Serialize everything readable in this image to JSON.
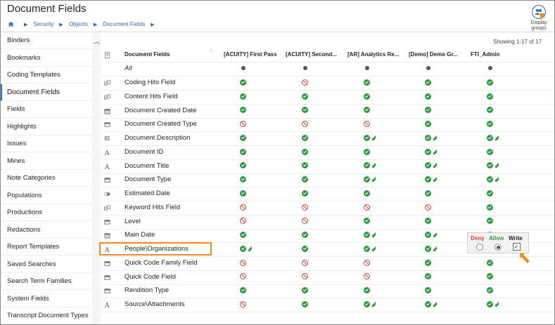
{
  "header": {
    "title": "Document Fields",
    "breadcrumb": [
      "Security",
      "Objects",
      "Document Fields"
    ],
    "display_groups_label_1": "Display",
    "display_groups_label_2": "groups"
  },
  "sidebar": {
    "items": [
      {
        "label": "Binders"
      },
      {
        "label": "Bookmarks"
      },
      {
        "label": "Coding Templates"
      },
      {
        "label": "Document Fields",
        "active": true
      },
      {
        "label": "Fields"
      },
      {
        "label": "Highlights"
      },
      {
        "label": "Issues"
      },
      {
        "label": "Mines"
      },
      {
        "label": "Note Categories"
      },
      {
        "label": "Populations"
      },
      {
        "label": "Productions"
      },
      {
        "label": "Redactions"
      },
      {
        "label": "Report Templates"
      },
      {
        "label": "Saved Searches"
      },
      {
        "label": "Search Term Families"
      },
      {
        "label": "System Fields"
      },
      {
        "label": "Transcript Document Types"
      }
    ]
  },
  "grid": {
    "showing": "Showing 1-17 of 17",
    "columns": [
      "Document Fields",
      "[ACUITY] First Pass",
      "[ACUITY] Second...",
      "[AR] Analytics Re...",
      "[Demo] Demo Gr...",
      "FTI_Admin"
    ],
    "all_label": "All",
    "rows": [
      {
        "name": "Coding Hits Field",
        "icon": "hits-field-icon",
        "perms": [
          "ok",
          "no",
          "ok",
          "ok",
          "ok"
        ],
        "write": [
          false,
          false,
          false,
          false,
          false
        ]
      },
      {
        "name": "Content Hits Field",
        "icon": "hits-field-icon",
        "perms": [
          "ok",
          "ok",
          "ok",
          "ok",
          "ok"
        ],
        "write": [
          false,
          false,
          false,
          false,
          false
        ]
      },
      {
        "name": "Document Created Date",
        "icon": "calendar-icon",
        "perms": [
          "ok",
          "ok",
          "ok",
          "ok",
          "ok"
        ],
        "write": [
          false,
          false,
          false,
          false,
          false
        ]
      },
      {
        "name": "Document Created Type",
        "icon": "pick-list-icon",
        "perms": [
          "no",
          "no",
          "no",
          "ok",
          "ok"
        ],
        "write": [
          false,
          false,
          false,
          false,
          false
        ]
      },
      {
        "name": "Document Description",
        "icon": "paragraph-icon",
        "perms": [
          "ok",
          "ok",
          "ok",
          "ok",
          "ok"
        ],
        "write": [
          false,
          false,
          true,
          true,
          true
        ]
      },
      {
        "name": "Document ID",
        "icon": "text-field-icon",
        "perms": [
          "ok",
          "ok",
          "ok",
          "ok",
          "ok"
        ],
        "write": [
          false,
          false,
          false,
          true,
          false
        ]
      },
      {
        "name": "Document Title",
        "icon": "text-field-icon",
        "perms": [
          "ok",
          "ok",
          "ok",
          "ok",
          "ok"
        ],
        "write": [
          false,
          false,
          true,
          true,
          true
        ]
      },
      {
        "name": "Document Type",
        "icon": "pick-list-icon",
        "perms": [
          "ok",
          "ok",
          "ok",
          "ok",
          "ok"
        ],
        "write": [
          false,
          false,
          true,
          true,
          true
        ]
      },
      {
        "name": "Estimated Date",
        "icon": "toggle-icon",
        "perms": [
          "ok",
          "ok",
          "ok",
          "ok",
          "ok"
        ],
        "write": [
          false,
          false,
          false,
          false,
          false
        ]
      },
      {
        "name": "Keyword Hits Field",
        "icon": "hits-field-icon",
        "perms": [
          "no",
          "no",
          "no",
          "no",
          "ok"
        ],
        "write": [
          false,
          false,
          false,
          false,
          false
        ]
      },
      {
        "name": "Level",
        "icon": "pick-list-icon",
        "perms": [
          "no",
          "no",
          "ok",
          "ok",
          "ok"
        ],
        "write": [
          false,
          false,
          false,
          false,
          false
        ]
      },
      {
        "name": "Main Date",
        "icon": "calendar-icon",
        "perms": [
          "ok",
          "ok",
          "ok",
          "ok",
          "ok"
        ],
        "write": [
          false,
          false,
          true,
          true,
          false
        ]
      },
      {
        "name": "People\\Organizations",
        "icon": "text-field-icon",
        "perms": [
          "ok",
          "ok",
          "ok",
          "ok",
          ""
        ],
        "write": [
          true,
          false,
          true,
          true,
          false
        ]
      },
      {
        "name": "Quick Code Family Field",
        "icon": "pick-list-icon",
        "perms": [
          "no",
          "no",
          "no",
          "ok",
          "ok"
        ],
        "write": [
          false,
          false,
          false,
          false,
          false
        ]
      },
      {
        "name": "Quick Code Field",
        "icon": "pick-list-icon",
        "perms": [
          "no",
          "no",
          "no",
          "ok",
          "ok"
        ],
        "write": [
          false,
          false,
          false,
          false,
          false
        ]
      },
      {
        "name": "Rendition Type",
        "icon": "pick-list-icon",
        "perms": [
          "ok",
          "ok",
          "ok",
          "ok",
          "ok"
        ],
        "write": [
          false,
          false,
          false,
          false,
          false
        ]
      },
      {
        "name": "Source\\Attachments",
        "icon": "text-field-icon",
        "perms": [
          "no",
          "ok",
          "ok",
          "ok",
          "ok"
        ],
        "write": [
          false,
          false,
          true,
          true,
          true
        ]
      }
    ]
  },
  "popup": {
    "deny_label": "Deny",
    "allow_label": "Allow",
    "write_label": "Write",
    "selected": "Allow",
    "write_checked": true
  },
  "colors": {
    "allow": "#2a9a3a",
    "deny": "#d8413a",
    "link": "#2a6ebb",
    "highlight": "#f08a24"
  }
}
